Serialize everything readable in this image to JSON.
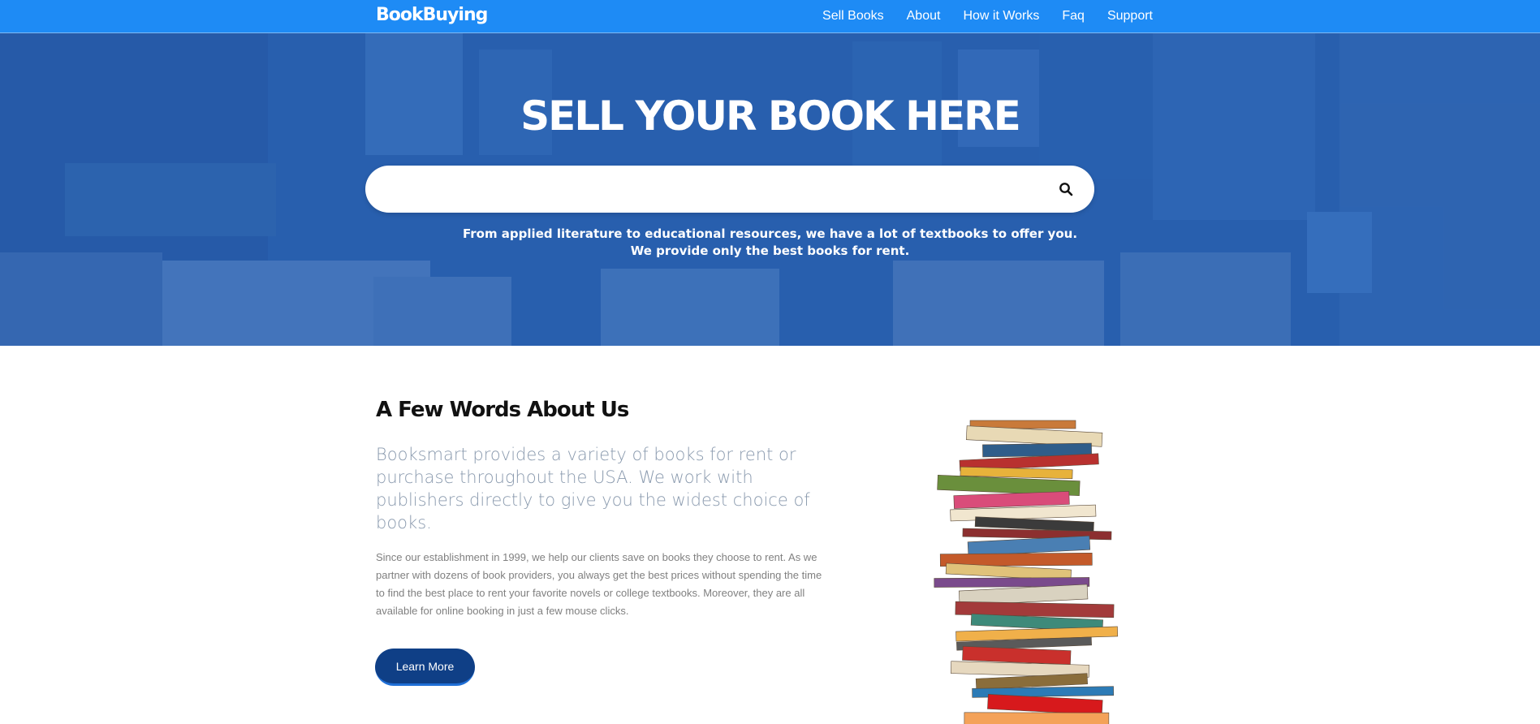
{
  "navbar": {
    "brand": "BookBuying",
    "links": [
      "Sell Books",
      "About",
      "How it Works",
      "Faq",
      "Support"
    ],
    "color": "#1e8bf5"
  },
  "hero": {
    "title": "SELL YOUR BOOK HERE",
    "search_placeholder": "",
    "search_icon": "search-icon",
    "subtitle_line1": "From applied literature to educational resources, we have a lot of textbooks to offer you.",
    "subtitle_line2": "We provide only the best books for rent."
  },
  "about": {
    "title": "A Few Words About Us",
    "lead": "Booksmart provides a variety of books for rent or purchase throughout the USA. We work with publishers directly to give you the widest choice of books.",
    "body": "Since our establishment in 1999, we help our clients save on books they choose to rent. As we partner with dozens of book providers, you always get the best prices without spending the time to find the best place to rent your favorite novels or college textbooks. Moreover, they are all available for online booking in just a few mouse clicks.",
    "button_label": "Learn More",
    "button_color": "#0f3f86"
  }
}
